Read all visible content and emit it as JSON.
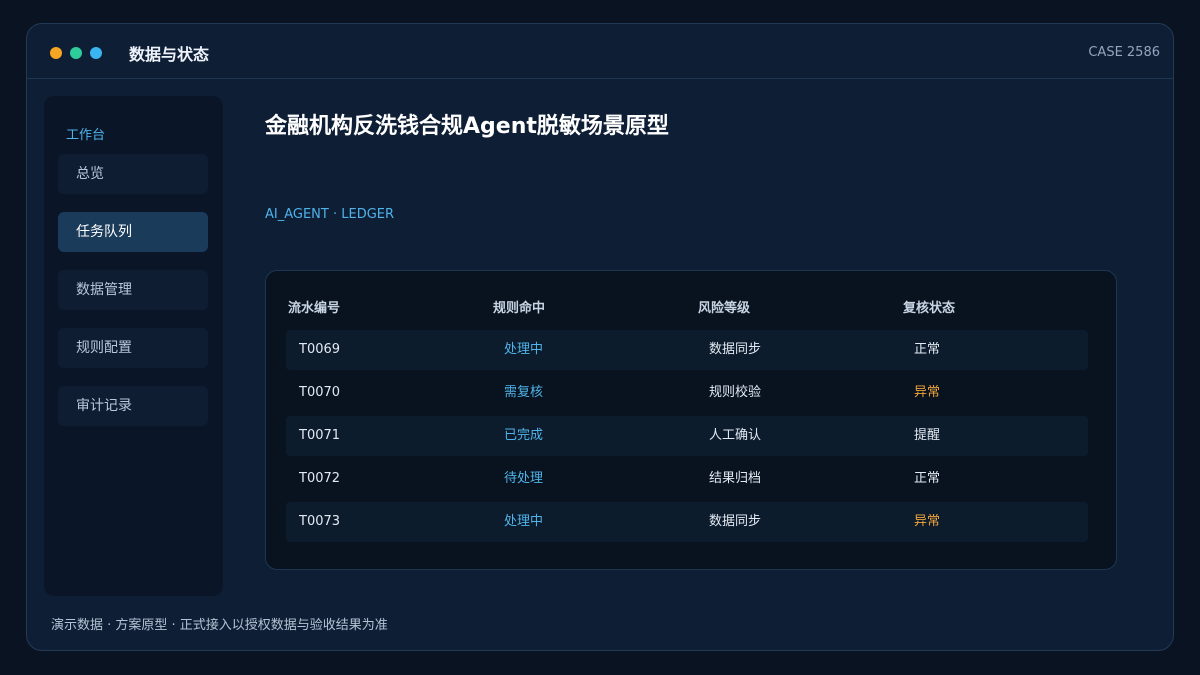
{
  "window": {
    "title": "数据与状态",
    "case_id": "CASE 2586",
    "dots": [
      "#f5a623",
      "#2ecc9a",
      "#3bb4f2"
    ]
  },
  "sidebar": {
    "heading": "工作台",
    "items": [
      {
        "label": "总览",
        "active": false
      },
      {
        "label": "任务队列",
        "active": true
      },
      {
        "label": "数据管理",
        "active": false
      },
      {
        "label": "规则配置",
        "active": false
      },
      {
        "label": "审计记录",
        "active": false
      }
    ]
  },
  "main": {
    "title": "金融机构反洗钱合规Agent脱敏场景原型",
    "meta": "AI_AGENT · LEDGER"
  },
  "table": {
    "headers": [
      "流水编号",
      "规则命中",
      "风险等级",
      "复核状态"
    ],
    "rows": [
      {
        "id": "T0069",
        "rule": "处理中",
        "risk": "数据同步",
        "review": "正常"
      },
      {
        "id": "T0070",
        "rule": "需复核",
        "risk": "规则校验",
        "review": "异常"
      },
      {
        "id": "T0071",
        "rule": "已完成",
        "risk": "人工确认",
        "review": "提醒"
      },
      {
        "id": "T0072",
        "rule": "待处理",
        "risk": "结果归档",
        "review": "正常"
      },
      {
        "id": "T0073",
        "rule": "处理中",
        "risk": "数据同步",
        "review": "异常"
      }
    ]
  },
  "footer": "演示数据 · 方案原型 · 正式接入以授权数据与验收结果为准",
  "colors": {
    "accent_blue": "#4fb3ea",
    "warning_orange": "#f0a43a",
    "background": "#0e1e35"
  }
}
